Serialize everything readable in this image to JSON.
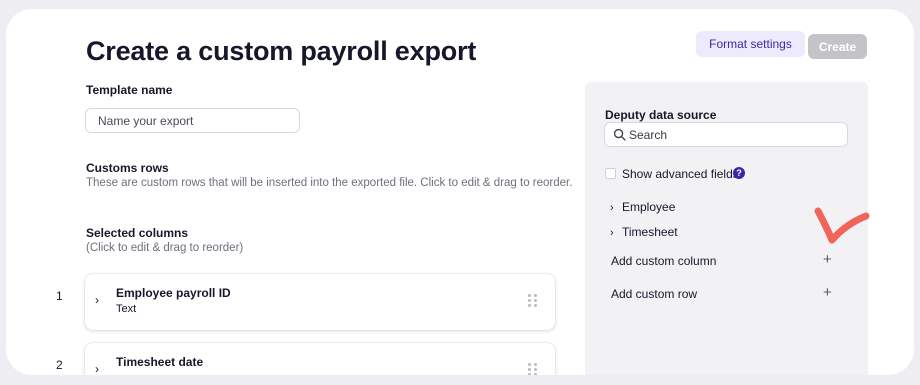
{
  "page": {
    "title": "Create a custom payroll export"
  },
  "toolbar": {
    "format_settings_label": "Format settings",
    "create_label": "Create"
  },
  "template": {
    "label": "Template name",
    "placeholder": "Name your export"
  },
  "custom_rows": {
    "title": "Customs rows",
    "description": "These are custom rows that will be inserted into the exported file. Click to edit & drag to reorder."
  },
  "selected_columns": {
    "title": "Selected columns",
    "hint": "(Click to edit & drag to reorder)",
    "items": [
      {
        "number": "1",
        "name": "Employee payroll ID",
        "type": "Text"
      },
      {
        "number": "2",
        "name": "Timesheet date",
        "type": ""
      }
    ]
  },
  "data_source": {
    "title": "Deputy data source",
    "search_placeholder": "Search",
    "advanced_fields_label": "Show advanced fields",
    "help_glyph": "?",
    "tree": [
      {
        "label": "Employee",
        "icon": "chevron-right-icon"
      },
      {
        "label": "Timesheet",
        "icon": "chevron-right-icon"
      }
    ],
    "add_custom_column_label": "Add custom column",
    "add_custom_row_label": "Add custom row",
    "plus_glyph": "+"
  },
  "colors": {
    "accent": "#3b2aa8",
    "format_button_bg": "#eceafc",
    "create_button_bg": "#c4c4c8",
    "panel_bg": "#f2f2f4",
    "annotation_check": "#f0645c"
  }
}
